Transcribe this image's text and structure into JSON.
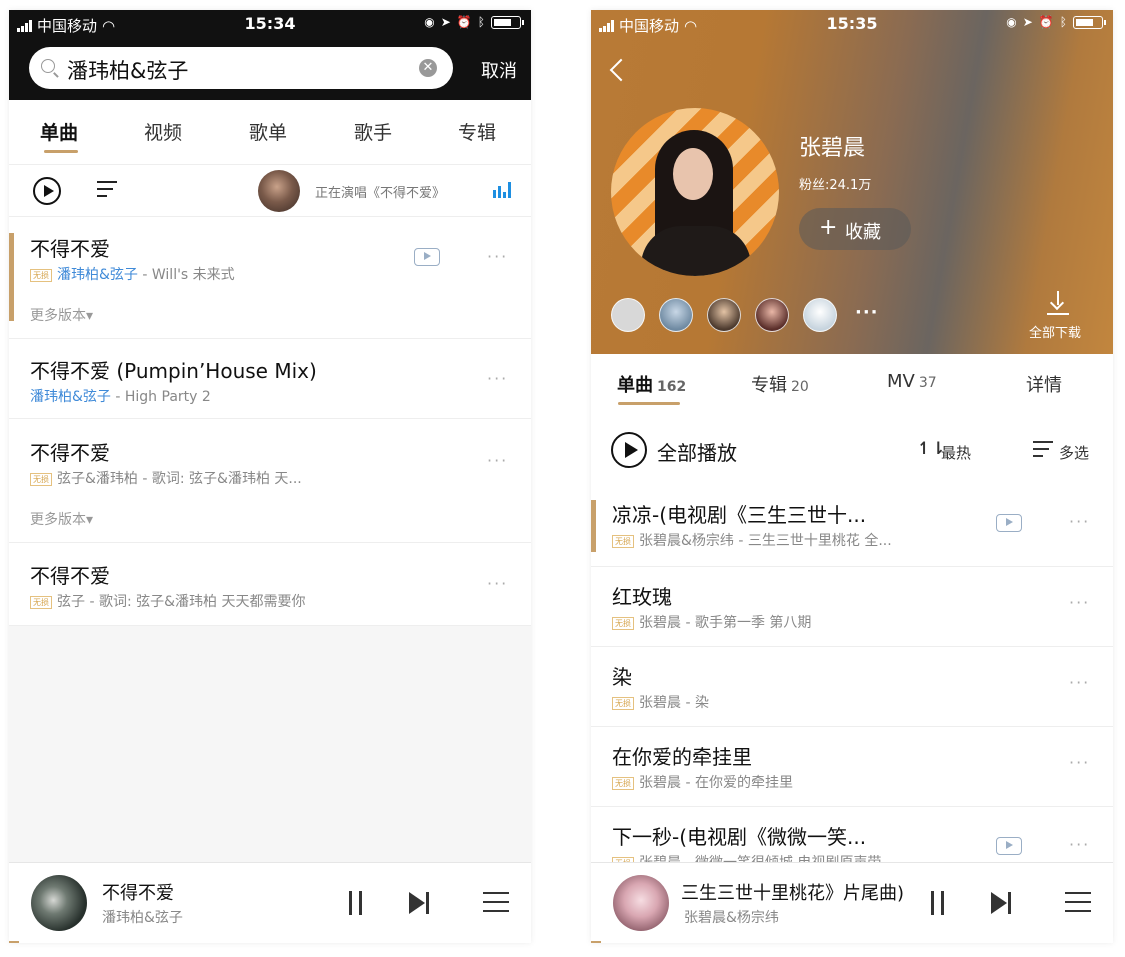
{
  "left": {
    "status": {
      "carrier": "中国移动",
      "time": "15:34"
    },
    "search": {
      "query": "潘玮柏&弦子",
      "cancel": "取消"
    },
    "tabs": [
      "单曲",
      "视频",
      "歌单",
      "歌手",
      "专辑"
    ],
    "toolbar": {
      "now_playing": "正在演唱《不得不爱》"
    },
    "songs": [
      {
        "title": "不得不爱",
        "badge": "无损",
        "artist": "潘玮柏&弦子",
        "detail": " - Will's 未来式",
        "more_versions": "更多版本▾"
      },
      {
        "title": "不得不爱 (Pumpin’House Mix)",
        "artist": "潘玮柏&弦子",
        "detail": " - High Party 2"
      },
      {
        "title": "不得不爱",
        "badge": "无损",
        "detail": "弦子&潘玮柏 - 歌词: 弦子&潘玮柏  天...",
        "more_versions": "更多版本▾"
      },
      {
        "title": "不得不爱",
        "badge": "无损",
        "detail": "弦子 - 歌词: 弦子&潘玮柏  天天都需要你"
      }
    ],
    "player": {
      "title": "不得不爱",
      "artist": "潘玮柏&弦子"
    },
    "more_glyph": "···"
  },
  "right": {
    "status": {
      "carrier": "中国移动",
      "time": "15:35"
    },
    "artist": {
      "name": "张碧晨",
      "fans": "粉丝:24.1万",
      "favorite": "收藏",
      "favorite_icon": "+"
    },
    "download_all": "全部下载",
    "similar_more": "···",
    "tabs": [
      {
        "label": "单曲",
        "count": "162"
      },
      {
        "label": "专辑",
        "count": "20"
      },
      {
        "label": "MV",
        "count": "37"
      },
      {
        "label": "详情",
        "count": ""
      }
    ],
    "actions": {
      "play_all": "全部播放",
      "sort_icon": "↿⇂",
      "sort": "最热",
      "multi": "多选"
    },
    "songs": [
      {
        "title": "凉凉-(电视剧《三生三世十...",
        "badge": "无损",
        "detail": "张碧晨&杨宗纬 - 三生三世十里桃花 全..."
      },
      {
        "title": "红玫瑰",
        "badge": "无损",
        "detail": "张碧晨 - 歌手第一季 第八期"
      },
      {
        "title": "染",
        "badge": "无损",
        "detail": "张碧晨 - 染"
      },
      {
        "title": "在你爱的牵挂里",
        "badge": "无损",
        "detail": "张碧晨 - 在你爱的牵挂里"
      },
      {
        "title": "下一秒-(电视剧《微微一笑...",
        "badge": "无损",
        "detail": "张碧晨 - 微微一笑很倾城 电视剧原声带"
      }
    ],
    "player": {
      "title": "三生三世十里桃花》片尾曲)  凉",
      "artist": "张碧晨&杨宗纬"
    }
  },
  "colors": {
    "accent": "#c8a06a",
    "link": "#3f8ad8",
    "badge": "#d6a650",
    "header_orange": "#b87a36"
  }
}
